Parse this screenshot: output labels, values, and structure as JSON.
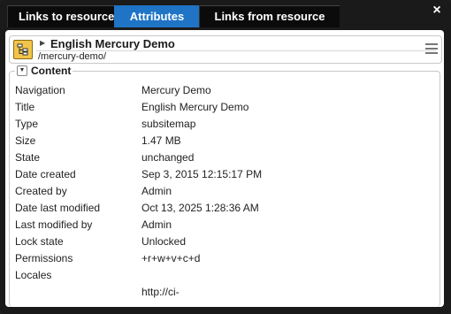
{
  "tabs": [
    {
      "label": "Links to resource"
    },
    {
      "label": "Attributes"
    },
    {
      "label": "Links from resource"
    }
  ],
  "close_label": "×",
  "resource": {
    "title": "English Mercury Demo",
    "path": "/mercury-demo/"
  },
  "section": {
    "label": "Content",
    "toggle": "▼"
  },
  "attributes": [
    {
      "key": "Navigation",
      "value": "Mercury Demo"
    },
    {
      "key": "Title",
      "value": "English Mercury Demo"
    },
    {
      "key": "Type",
      "value": "subsitemap"
    },
    {
      "key": "Size",
      "value": "1.47 MB"
    },
    {
      "key": "State",
      "value": "unchanged"
    },
    {
      "key": "Date created",
      "value": "Sep 3, 2015 12:15:17 PM"
    },
    {
      "key": "Created by",
      "value": "Admin"
    },
    {
      "key": "Date last modified",
      "value": "Oct 13, 2025 1:28:36 AM"
    },
    {
      "key": "Last modified by",
      "value": "Admin"
    },
    {
      "key": "Lock state",
      "value": "Unlocked"
    },
    {
      "key": "Permissions",
      "value": "+r+w+v+c+d"
    },
    {
      "key": "Locales",
      "value": ""
    },
    {
      "key": "",
      "value": "http://ci-"
    }
  ],
  "colors": {
    "accent": "#1f74c6",
    "titlebar": "#1a1a1a"
  }
}
